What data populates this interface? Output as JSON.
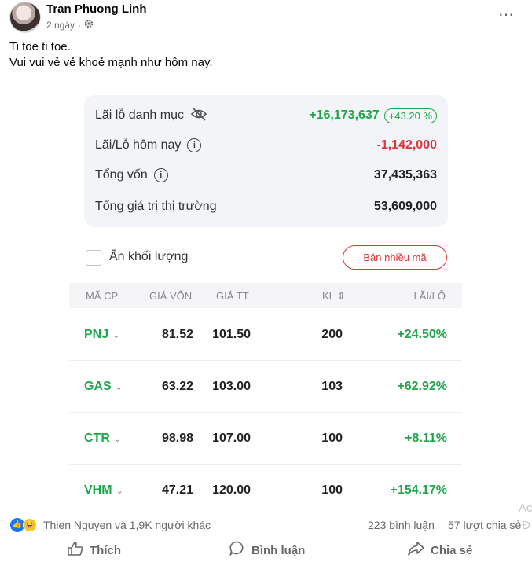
{
  "post": {
    "author": "Tran Phuong Linh",
    "time": "2 ngày",
    "separator": "·",
    "more_icon": "⋯",
    "text_line1": "Ti toe ti toe.",
    "text_line2": "Vui vui vẻ vẻ khoẻ mạnh như hôm nay."
  },
  "summary": {
    "portfolio_pl_label": "Lãi lỗ danh mục",
    "portfolio_pl_value": "+16,173,637",
    "portfolio_pl_pct": "+43.20 %",
    "today_pl_label": "Lãi/Lỗ hôm nay",
    "today_pl_value": "-1,142,000",
    "capital_label": "Tổng vốn",
    "capital_value": "37,435,363",
    "market_value_label": "Tổng giá trị thị trường",
    "market_value_value": "53,609,000"
  },
  "controls": {
    "hide_volume_label": "Ẩn khối lượng",
    "sell_many_label": "Bán nhiều mã"
  },
  "table": {
    "headers": [
      "MÃ CP",
      "GIÁ VỐN",
      "GIÁ TT",
      "KL ⇕",
      "LÃI/LỖ"
    ],
    "rows": [
      {
        "ticker": "PNJ",
        "cost": "81.52",
        "price": "101.50",
        "qty": "200",
        "pl": "+24.50%"
      },
      {
        "ticker": "GAS",
        "cost": "63.22",
        "price": "103.00",
        "qty": "103",
        "pl": "+62.92%"
      },
      {
        "ticker": "CTR",
        "cost": "98.98",
        "price": "107.00",
        "qty": "100",
        "pl": "+8.11%"
      },
      {
        "ticker": "VHM",
        "cost": "47.21",
        "price": "120.00",
        "qty": "100",
        "pl": "+154.17%"
      }
    ]
  },
  "footer": {
    "reactions_text": "Thien Nguyen và 1,9K người khác",
    "comments": "223 bình luận",
    "shares": "57 lượt chia sẻ",
    "ad_hint_top": "Ac",
    "ad_hint_bottom": "Đ",
    "like_label": "Thích",
    "comment_label": "Bình luận",
    "share_label": "Chia sẻ"
  },
  "colors": {
    "positive": "#1fa64a",
    "negative": "#e0333b",
    "facebook_blue": "#1877f2"
  }
}
